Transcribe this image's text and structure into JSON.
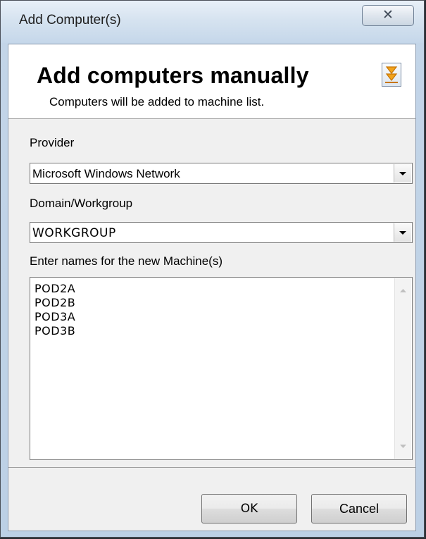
{
  "window": {
    "title": "Add Computer(s)",
    "close_icon": "close-icon",
    "close_symbol": "✕"
  },
  "header": {
    "title": "Add computers manually",
    "subtitle": "Computers will be added to machine list.",
    "expand_icon": "double-chevron-down-icon"
  },
  "form": {
    "provider_label": "Provider",
    "provider_value": "Microsoft Windows Network",
    "domain_label": "Domain/Workgroup",
    "domain_value": "WORKGROUP",
    "names_label": "Enter names for the new Machine(s)",
    "names": [
      "POD2A",
      "POD2B",
      "POD3A",
      "POD3B"
    ]
  },
  "buttons": {
    "ok_label": "OK",
    "cancel_label": "Cancel"
  },
  "colors": {
    "accent": "#f2a31b",
    "accent_dark": "#c77606"
  }
}
